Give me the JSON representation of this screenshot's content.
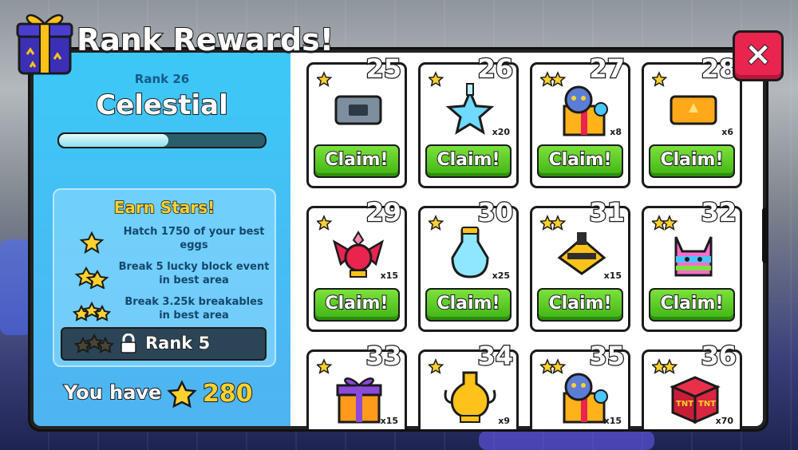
{
  "title": "Rank Rewards!",
  "close_label": "×",
  "rank": {
    "label": "Rank 26",
    "name": "Celestial",
    "progress": 0.53
  },
  "earn": {
    "title": "Earn Stars!",
    "tasks": [
      {
        "stars": 1,
        "text": "Hatch 1750 of your best eggs"
      },
      {
        "stars": 2,
        "text": "Break 5 lucky block event in best area"
      },
      {
        "stars": 3,
        "text": "Break 3.25k breakables in best area"
      }
    ],
    "locked": {
      "label": "Rank 5"
    }
  },
  "wallet": {
    "label": "You have",
    "count": "280"
  },
  "claim_label": "Claim!",
  "rewards": [
    {
      "num": "25",
      "stars": 1,
      "icon": "ticket-silver-icon",
      "qty": ""
    },
    {
      "num": "26",
      "stars": 1,
      "icon": "crystal-star-icon",
      "qty": "x20"
    },
    {
      "num": "27",
      "stars": 2,
      "icon": "pet-gift-icon",
      "qty": "x8"
    },
    {
      "num": "28",
      "stars": 1,
      "icon": "ticket-gold-icon",
      "qty": "x6"
    },
    {
      "num": "29",
      "stars": 1,
      "icon": "winged-potion-icon",
      "qty": "x15"
    },
    {
      "num": "30",
      "stars": 1,
      "icon": "blue-potion-icon",
      "qty": "x25"
    },
    {
      "num": "31",
      "stars": 2,
      "icon": "gold-flag-icon",
      "qty": "x15"
    },
    {
      "num": "32",
      "stars": 2,
      "icon": "pinata-icon",
      "qty": ""
    },
    {
      "num": "33",
      "stars": 1,
      "icon": "orange-gift-icon",
      "qty": "x15"
    },
    {
      "num": "34",
      "stars": 1,
      "icon": "gold-potion-icon",
      "qty": "x9"
    },
    {
      "num": "35",
      "stars": 2,
      "icon": "pet-gift-icon",
      "qty": "x15"
    },
    {
      "num": "36",
      "stars": 2,
      "icon": "tnt-crate-icon",
      "qty": "x70"
    }
  ],
  "colors": {
    "accent": "#3cc8f7",
    "claim": "#4fc21f",
    "close": "#e8244f",
    "star": "#ffd12e"
  }
}
